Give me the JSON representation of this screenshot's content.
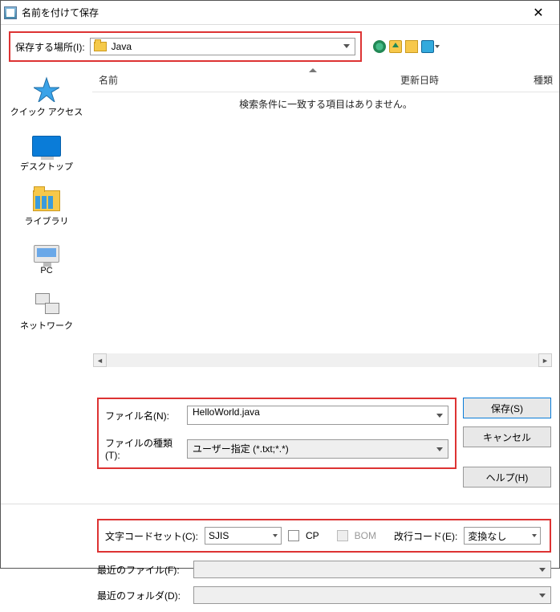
{
  "window": {
    "title": "名前を付けて保存"
  },
  "location": {
    "label": "保存する場所(I):",
    "value": "Java"
  },
  "sidebar": {
    "items": [
      {
        "label": "クイック アクセス"
      },
      {
        "label": "デスクトップ"
      },
      {
        "label": "ライブラリ"
      },
      {
        "label": "PC"
      },
      {
        "label": "ネットワーク"
      }
    ]
  },
  "columns": {
    "name": "名前",
    "date": "更新日時",
    "type": "種類"
  },
  "empty_message": "検索条件に一致する項目はありません。",
  "filename": {
    "label": "ファイル名(N):",
    "value": "HelloWorld.java"
  },
  "filetype": {
    "label": "ファイルの種類(T):",
    "value": "ユーザー指定 (*.txt;*.*)"
  },
  "buttons": {
    "save": "保存(S)",
    "cancel": "キャンセル",
    "help": "ヘルプ(H)"
  },
  "encoding": {
    "label": "文字コードセット(C):",
    "value": "SJIS",
    "cp_label": "CP",
    "bom_label": "BOM",
    "newline_label": "改行コード(E):",
    "newline_value": "変換なし"
  },
  "recent": {
    "files_label": "最近のファイル(F):",
    "folders_label": "最近のフォルダ(D):"
  }
}
